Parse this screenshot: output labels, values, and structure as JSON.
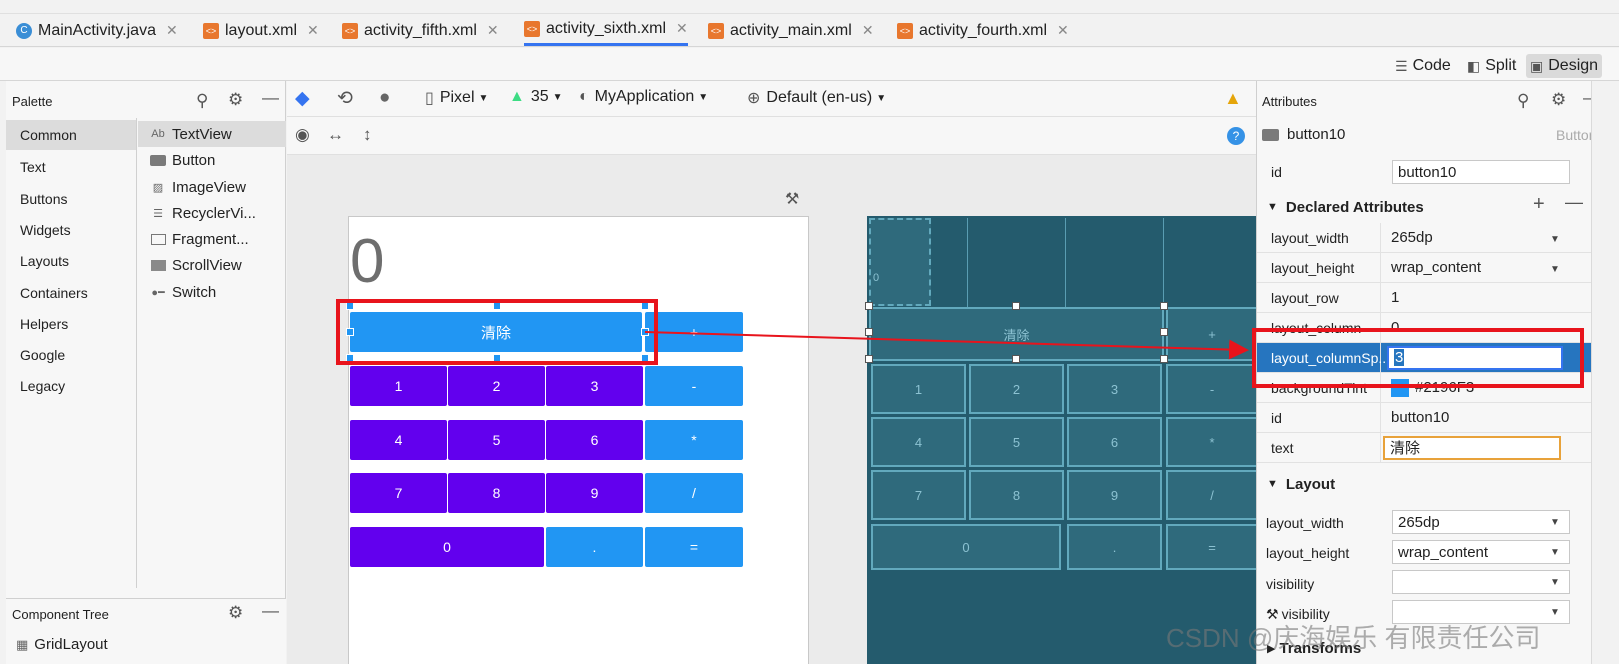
{
  "tabs": [
    {
      "label": "MainActivity.java",
      "kind": "java"
    },
    {
      "label": "layout.xml",
      "kind": "xml"
    },
    {
      "label": "activity_fifth.xml",
      "kind": "xml"
    },
    {
      "label": "activity_sixth.xml",
      "kind": "xml",
      "active": true
    },
    {
      "label": "activity_main.xml",
      "kind": "xml"
    },
    {
      "label": "activity_fourth.xml",
      "kind": "xml"
    }
  ],
  "modes": {
    "code": "Code",
    "split": "Split",
    "design": "Design"
  },
  "palette": {
    "title": "Palette",
    "categories": [
      "Common",
      "Text",
      "Buttons",
      "Widgets",
      "Layouts",
      "Containers",
      "Helpers",
      "Google",
      "Legacy"
    ],
    "components": [
      {
        "label": "TextView",
        "icon": "Ab"
      },
      {
        "label": "Button",
        "icon": "button-icon"
      },
      {
        "label": "ImageView",
        "icon": "image-icon"
      },
      {
        "label": "RecyclerVi...",
        "icon": "list-icon"
      },
      {
        "label": "Fragment...",
        "icon": "fragment-icon"
      },
      {
        "label": "ScrollView",
        "icon": "scroll-icon"
      },
      {
        "label": "Switch",
        "icon": "switch-icon"
      }
    ]
  },
  "component_tree": {
    "title": "Component Tree",
    "root": "GridLayout"
  },
  "toolbar": {
    "device": "Pixel",
    "api": "35",
    "theme": "MyApplication",
    "locale": "Default (en-us)"
  },
  "calculator": {
    "display": "0",
    "clear_label": "清除",
    "keys": [
      "+",
      "1",
      "2",
      "3",
      "-",
      "4",
      "5",
      "6",
      "*",
      "7",
      "8",
      "9",
      "/",
      "0",
      ".",
      "="
    ]
  },
  "attributes": {
    "title": "Attributes",
    "component_name": "button10",
    "component_type": "Button",
    "id_label": "id",
    "id_value": "button10",
    "declared_title": "Declared Attributes",
    "declared": [
      {
        "k": "layout_width",
        "v": "265dp"
      },
      {
        "k": "layout_height",
        "v": "wrap_content"
      },
      {
        "k": "layout_row",
        "v": "1"
      },
      {
        "k": "layout_column",
        "v": "0"
      },
      {
        "k": "layout_columnSp...",
        "v": "3"
      },
      {
        "k": "backgroundTint",
        "v": "#2196F3"
      },
      {
        "k": "id",
        "v": "button10"
      },
      {
        "k": "text",
        "v": "清除"
      }
    ],
    "layout_title": "Layout",
    "layout": [
      {
        "k": "layout_width",
        "v": "265dp"
      },
      {
        "k": "layout_height",
        "v": "wrap_content"
      },
      {
        "k": "visibility",
        "v": ""
      },
      {
        "k": "visibility",
        "v": ""
      }
    ],
    "transforms_title": "Transforms"
  },
  "watermark": "CSDN @庆海娱乐 有限责任公司",
  "colors": {
    "purple": "#6200ee",
    "blue": "#2196f3",
    "blueprint": "#245b6d",
    "highlight": "#e8141c"
  }
}
